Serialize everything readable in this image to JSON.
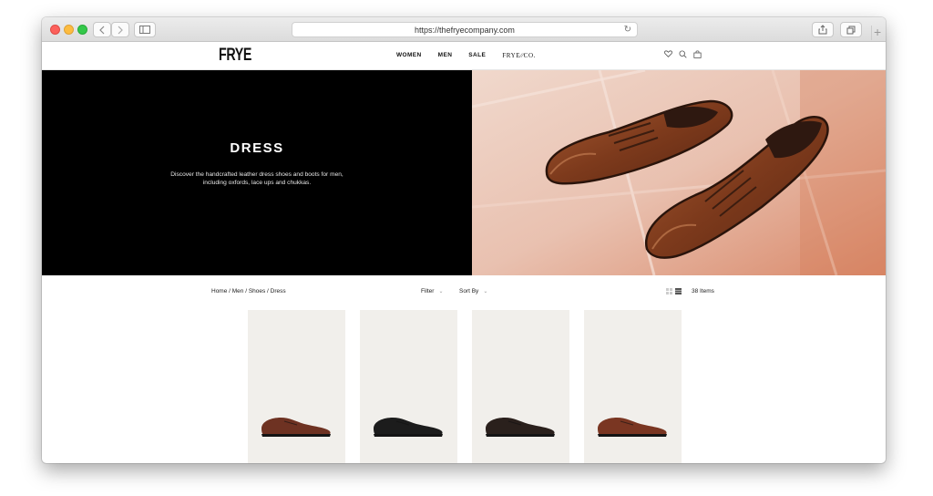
{
  "browser": {
    "url": "https://thefryecompany.com"
  },
  "header": {
    "logo": "FRYE",
    "nav": [
      {
        "label": "WOMEN"
      },
      {
        "label": "MEN"
      },
      {
        "label": "SALE"
      },
      {
        "label": "FRYE∕∕CO."
      }
    ],
    "icons": [
      "heart-icon",
      "search-icon",
      "bag-icon"
    ]
  },
  "hero": {
    "title": "DRESS",
    "description": "Discover the handcrafted leather dress shoes and boots for men, including oxfords, lace ups and chukkas."
  },
  "toolbar": {
    "breadcrumb": "Home / Men / Shoes / Dress",
    "filter_label": "Filter",
    "sort_label": "Sort By",
    "item_count": "38 Items"
  },
  "products": [
    {
      "shoe_color": "#6e3222"
    },
    {
      "shoe_color": "#1c1c1c"
    },
    {
      "shoe_color": "#2a201c"
    },
    {
      "shoe_color": "#7a3622"
    }
  ],
  "colors": {
    "hero_bg": "#000000",
    "card_bg": "#f1efeb"
  }
}
